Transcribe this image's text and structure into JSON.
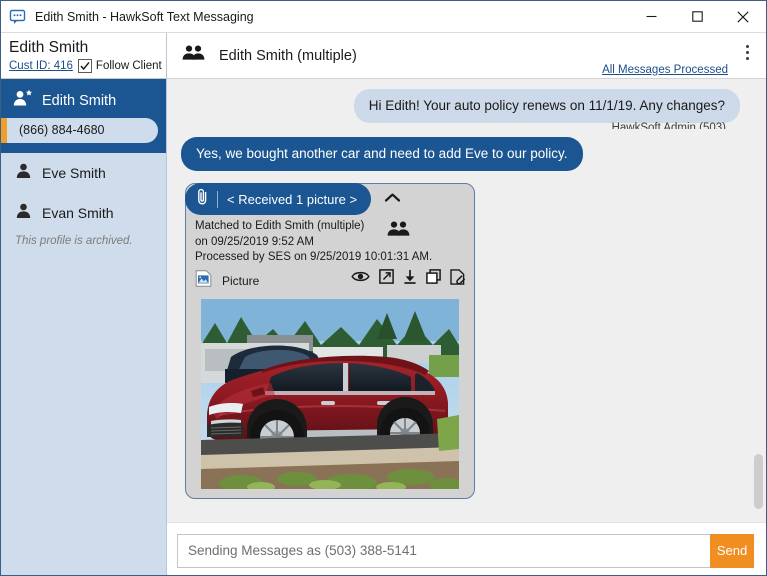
{
  "window": {
    "title": "Edith Smith - HawkSoft Text Messaging",
    "icon": "chat-bubble-icon",
    "minimize_label": "Minimize",
    "maximize_label": "Maximize",
    "close_label": "Close"
  },
  "sidebar": {
    "client_name": "Edith Smith",
    "cust_id_label": "Cust ID: 416",
    "follow_client_label": "Follow Client",
    "follow_client_checked": true,
    "selected_contact": {
      "name": "Edith Smith",
      "phone": "(866) 884-4680",
      "icon": "user-star-icon"
    },
    "contacts": [
      {
        "name": "Eve Smith",
        "icon": "user-icon"
      },
      {
        "name": "Evan Smith",
        "icon": "user-icon"
      }
    ],
    "archived_note": "This profile is archived."
  },
  "conversation": {
    "header": {
      "title": "Edith Smith (multiple)",
      "group_icon": "group-icon",
      "all_processed_link": "All Messages Processed",
      "overflow_menu": "more-options",
      "clipped_text": "HawkSoft Admin (503)"
    },
    "messages": [
      {
        "direction": "incoming",
        "text": "Hi Edith! Your auto policy renews on 11/1/19. Any changes?"
      },
      {
        "direction": "outgoing",
        "text": "Yes, we bought another car and need to add Eve to our policy."
      }
    ],
    "attachment": {
      "chip_label": "< Received 1 picture >",
      "paperclip_icon": "paperclip-icon",
      "collapse_icon": "chevron-up-icon",
      "matched_line1": "Matched to Edith Smith (multiple)",
      "matched_line2": "on 09/25/2019 9:52 AM",
      "processed_line": "Processed by SES on 9/25/2019 10:01:31 AM.",
      "group_icon": "group-icon",
      "file_icon": "image-file-icon",
      "file_label": "Picture",
      "actions": [
        {
          "name": "view-icon",
          "label": "View"
        },
        {
          "name": "open-external-icon",
          "label": "Open"
        },
        {
          "name": "download-icon",
          "label": "Download"
        },
        {
          "name": "copy-icon",
          "label": "Copy"
        },
        {
          "name": "attach-document-icon",
          "label": "Attach"
        }
      ],
      "photo_alt": "Red SUV parked outdoors"
    }
  },
  "composer": {
    "placeholder": "Sending Messages as (503) 388-5141",
    "value": "",
    "send_label": "Send"
  },
  "colors": {
    "brand_blue": "#1b5693",
    "sidebar_blue": "#cfdcec",
    "accent_orange": "#f0a02a",
    "send_orange": "#f08e22",
    "link_blue": "#1a4f8a",
    "chat_bg": "#efefef"
  }
}
